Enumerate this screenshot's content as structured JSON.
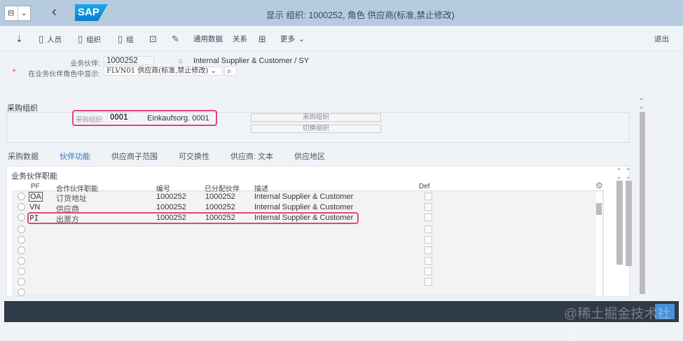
{
  "shell": {
    "title": "显示 组织: 1000252, 角色 供应商(标准,禁止修改)",
    "logo": "SAP",
    "back": "‹"
  },
  "toolbar": {
    "items": [
      "人员",
      "组织",
      "组",
      "通用数据",
      "关系",
      "更多"
    ],
    "exit": "退出"
  },
  "header": {
    "partner_label": "业务伙伴:",
    "partner_value": "1000252",
    "partner_desc": "Internal Supplier & Customer / SY",
    "role_label": "在业务伙伴角色中显示:",
    "role_value": "FLVN01 供应商(标准,禁止修改)",
    "required": "*"
  },
  "porg": {
    "section": "采购组织",
    "label": "采购组织:",
    "value": "0001",
    "desc": "Einkaufsorg. 0001",
    "btn1": "采购组织",
    "btn2": "切换组织"
  },
  "tabs": [
    "采购数据",
    "伙伴功能",
    "供应商子范围",
    "可交换性",
    "供应商: 文本",
    "供应地区"
  ],
  "table": {
    "title": "业务伙伴职能",
    "headers": [
      "PF",
      "合作伙伴职能",
      "编号",
      "已分配伙伴",
      "描述",
      "Def"
    ],
    "rows": [
      {
        "pf": "OA",
        "func": "订货地址",
        "num": "1000252",
        "partner": "1000252",
        "desc": "Internal Supplier & Customer"
      },
      {
        "pf": "VN",
        "func": "供应商",
        "num": "1000252",
        "partner": "1000252",
        "desc": "Internal Supplier & Customer"
      },
      {
        "pf": "PI",
        "func": "出票方",
        "num": "1000252",
        "partner": "1000252",
        "desc": "Internal Supplier & Customer"
      }
    ]
  },
  "watermark": "@稀土掘金技术社区"
}
